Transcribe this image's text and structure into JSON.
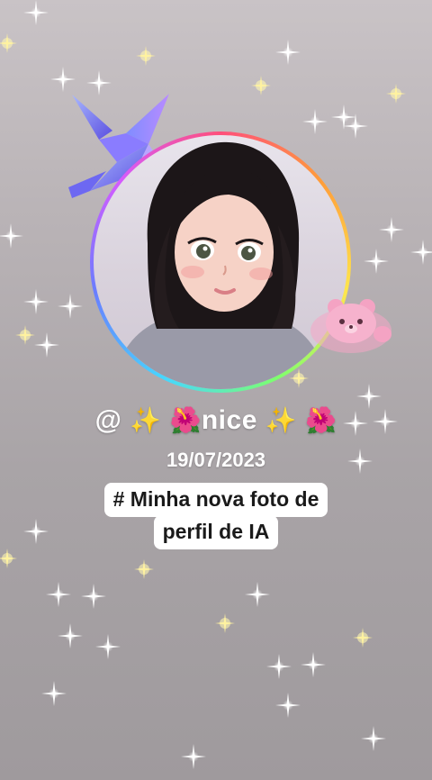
{
  "profile": {
    "name_prefix": "@",
    "name_sparkle_1": "✨",
    "name_flower_1": "🌺",
    "name_text": "nice",
    "name_sparkle_2": "✨",
    "name_flower_2": "🌺",
    "date": "19/07/2023"
  },
  "caption": {
    "line1": "# Minha nova foto de",
    "line2": "perfil de IA"
  },
  "colors": {
    "background_top": "#c9c3c6",
    "background_bottom": "#9f9a9d",
    "caption_bg": "#ffffff",
    "caption_text": "#1a1a1a",
    "ring_accent": "#ff4f7b"
  },
  "icons": {
    "crane": "origami-crane-icon",
    "bear": "pink-bear-icon",
    "sparkles": "sparkle-icon"
  }
}
